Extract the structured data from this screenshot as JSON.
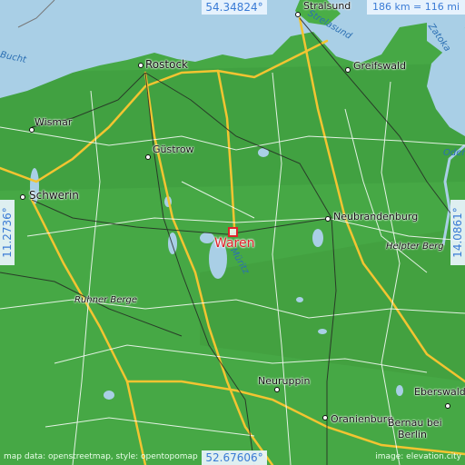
{
  "coords": {
    "top_lat": "54.34824°",
    "bottom_lat": "52.67606°",
    "left_lon": "11.2736°",
    "right_lon": "14.0861°"
  },
  "scale_text": "186 km = 116 mi",
  "marker": {
    "label": "Waren"
  },
  "cities": {
    "stralsund": "Stralsund",
    "rostock": "Rostock",
    "greifswald": "Greifswald",
    "wismar": "Wismar",
    "gustrow": "Güstrow",
    "schwerin": "Schwerin",
    "neubrandenburg": "Neubrandenburg",
    "neuruppin": "Neuruppin",
    "eberswalde": "Eberswalde",
    "oranienburg": "Oranienburg",
    "bernau": "Bernau bei",
    "berlin": "Berlin"
  },
  "water": {
    "bucht": "Bucht",
    "strelasund": "Strelasund",
    "zatoka": "Zatoka",
    "oder": "Oder",
    "muritz": "Müritz"
  },
  "hills": {
    "helpter": "Helpter Berg",
    "ruhner": "Ruhner Berge"
  },
  "attribution": {
    "left": "map data: openstreetmap, style: opentopomap",
    "right": "image: elevation.city"
  },
  "colors": {
    "land": "#46a845",
    "water": "#a9cfe6",
    "highway": "#f3c431",
    "road": "#ffffff",
    "marker": "#e0222a",
    "coord_text": "#3a7bd5"
  }
}
